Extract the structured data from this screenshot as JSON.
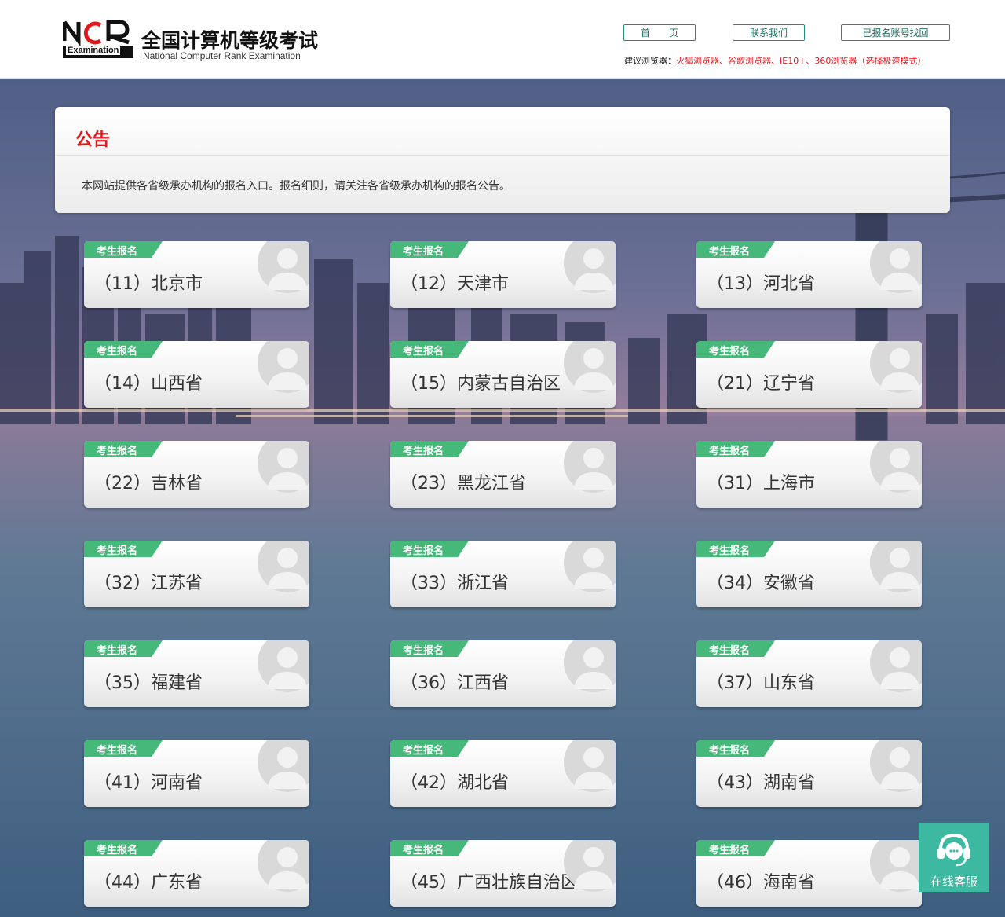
{
  "header": {
    "logo_mark": "NCR",
    "logo_mark_sub": "Examination",
    "logo_title": "全国计算机等级考试",
    "logo_subtitle": "National Computer Rank Examination",
    "nav": [
      {
        "label": "首　　页"
      },
      {
        "label": "联系我们"
      },
      {
        "label": "已报名账号找回"
      }
    ],
    "browser_tip_label": "建议浏览器：",
    "browser_tip_value": "火狐浏览器、谷歌浏览器、IE10+、360浏览器（选择极速模式）"
  },
  "notice": {
    "title": "公告",
    "text": "本网站提供各省级承办机构的报名入口。报名细则，请关注各省级承办机构的报名公告。"
  },
  "card_tag": "考生报名",
  "cards": [
    {
      "label": "（11）北京市"
    },
    {
      "label": "（12）天津市"
    },
    {
      "label": "（13）河北省"
    },
    {
      "label": "（14）山西省"
    },
    {
      "label": "（15）内蒙古自治区"
    },
    {
      "label": "（21）辽宁省"
    },
    {
      "label": "（22）吉林省"
    },
    {
      "label": "（23）黑龙江省"
    },
    {
      "label": "（31）上海市"
    },
    {
      "label": "（32）江苏省"
    },
    {
      "label": "（33）浙江省"
    },
    {
      "label": "（34）安徽省"
    },
    {
      "label": "（35）福建省"
    },
    {
      "label": "（36）江西省"
    },
    {
      "label": "（37）山东省"
    },
    {
      "label": "（41）河南省"
    },
    {
      "label": "（42）湖北省"
    },
    {
      "label": "（43）湖南省"
    },
    {
      "label": "（44）广东省"
    },
    {
      "label": "（45）广西壮族自治区"
    },
    {
      "label": "（46）海南省"
    }
  ],
  "service": {
    "label": "在线客服",
    "icon": "headset-icon"
  },
  "colors": {
    "accent_red": "#e0191d",
    "tag_green": "#45b87a",
    "service_teal": "#3cb9a0",
    "button_border": "#1f8f7a"
  }
}
